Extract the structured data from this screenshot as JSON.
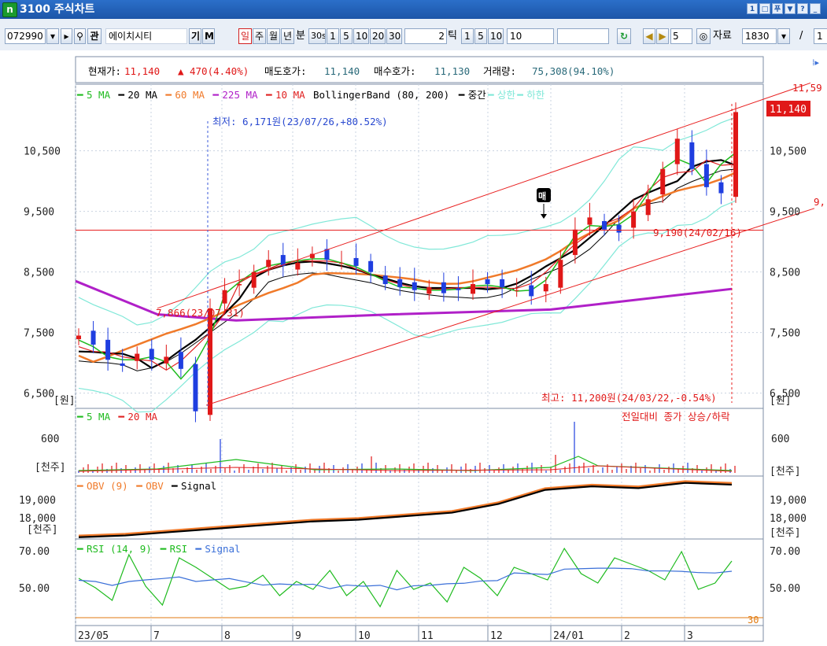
{
  "window": {
    "logo": "n",
    "title": "3100 주식차트",
    "controls": [
      "1",
      "□",
      "푸",
      "▼",
      "?",
      "_"
    ]
  },
  "toolbar": {
    "stock_code": "072990",
    "stock_name": "에이치시티",
    "gi_label": "기",
    "m_label": "M",
    "periods": [
      "일",
      "주",
      "월",
      "년",
      "분"
    ],
    "active_period": "일",
    "minute_buttons": [
      "30s",
      "1",
      "5",
      "10",
      "20",
      "30"
    ],
    "tick_value": "2",
    "tick_label": "틱",
    "tick_buttons": [
      "1",
      "5",
      "10"
    ],
    "tick_input": "10",
    "count_input": "5",
    "data_label": "자료",
    "data_count": "1830",
    "slash": "/",
    "page_value": "1"
  },
  "info": {
    "price_label": "현재가:",
    "price": "11,140",
    "change_arrow": "▲",
    "change": "470(4.40%)",
    "ask_label": "매도호가:",
    "ask": "11,140",
    "bid_label": "매수호가:",
    "bid": "11,130",
    "vol_label": "거래량:",
    "volume": "75,308(94.10%)"
  },
  "legend_main": [
    {
      "label": "5 MA",
      "color": "#1fbb1f"
    },
    {
      "label": "20 MA",
      "color": "#000000"
    },
    {
      "label": "60 MA",
      "color": "#f07a2a"
    },
    {
      "label": "225 MA",
      "color": "#b020c8"
    },
    {
      "label": "10 MA",
      "color": "#e02020"
    },
    {
      "label": "BollingerBand (80, 200)",
      "color": ""
    },
    {
      "label": "중간",
      "color": "#000000"
    },
    {
      "label": "상한",
      "color": "#80e8d8"
    },
    {
      "label": "하한",
      "color": "#80e8d8"
    }
  ],
  "annotations": {
    "low": "최저: 6,171원(23/07/26,+80.52%)",
    "high": "최고: 11,200원(24/03/22,-0.54%)",
    "level_1": "7,866(23/07/31)",
    "level_2": "9,190(24/02/16)",
    "buy_marker": "매",
    "trend_right_1": "11,59",
    "trend_right_2": "9,",
    "current_price_box": "11,140",
    "won_unit": "[원]"
  },
  "vol_panel": {
    "legend": [
      {
        "label": "5 MA",
        "color": "#1fbb1f"
      },
      {
        "label": "20 MA",
        "color": "#e02020"
      }
    ],
    "right_text": "전일대비 종가 상승/하락",
    "unit": "[천주]",
    "ticks": [
      "600"
    ]
  },
  "obv_panel": {
    "legend": [
      {
        "label": "OBV (9)",
        "color": "#f07a2a"
      },
      {
        "label": "OBV",
        "color": "#f07a2a"
      },
      {
        "label": "Signal",
        "color": "#000000"
      }
    ],
    "unit": "[천주]",
    "ticks": [
      "19,000",
      "18,000"
    ]
  },
  "rsi_panel": {
    "legend": [
      {
        "label": "RSI (14, 9)",
        "color": "#1fbb1f"
      },
      {
        "label": "RSI",
        "color": "#1fbb1f"
      },
      {
        "label": "Signal",
        "color": "#3a6fd8"
      }
    ],
    "ticks": [
      "70.00",
      "50.00"
    ],
    "corner": "30"
  },
  "price_axis": {
    "ticks": [
      "10,500",
      "9,500",
      "8,500",
      "7,500",
      "6,500"
    ]
  },
  "time_axis": [
    "23/05",
    "7",
    "8",
    "9",
    "10",
    "11",
    "12",
    "24/01",
    "2",
    "3"
  ],
  "colors": {
    "up": "#e01818",
    "down": "#1f3ee0",
    "grid": "#c9d3e0",
    "trend": "#e82020",
    "support": "#e82020"
  },
  "chart_data": {
    "type": "candlestick",
    "x_labels": [
      "23/05",
      "7",
      "8",
      "9",
      "10",
      "11",
      "12",
      "24/01",
      "2",
      "3"
    ],
    "price_range": [
      6300,
      11600
    ],
    "key_points": [
      {
        "date": "23/07/26",
        "value": 6171,
        "label": "최저"
      },
      {
        "date": "23/07/31",
        "value": 7866
      },
      {
        "date": "24/02/16",
        "value": 9190
      },
      {
        "date": "24/03/22",
        "value": 11200,
        "label": "최고"
      }
    ],
    "last_close": 11140,
    "horizontal_line": 9190,
    "price_path": [
      7450,
      7300,
      7050,
      6950,
      7150,
      7050,
      7100,
      6900,
      6200,
      7900,
      8200,
      8300,
      8500,
      8700,
      8600,
      8650,
      8800,
      8700,
      8650,
      8600,
      8500,
      8300,
      8250,
      8200,
      8250,
      8150,
      8200,
      8300,
      8300,
      8250,
      8200,
      8100,
      8300,
      8700,
      9200,
      9400,
      9200,
      9150,
      9500,
      9700,
      10200,
      10700,
      10200,
      9900,
      9800,
      11140
    ],
    "obv_path": [
      17.55,
      17.6,
      17.7,
      17.8,
      17.9,
      18.0,
      18.05,
      18.15,
      18.25,
      18.5,
      18.9,
      19.0,
      18.95,
      19.1,
      19.05
    ],
    "rsi_path": [
      55,
      49,
      41,
      70,
      50,
      38,
      68,
      62,
      55,
      48,
      50,
      57,
      44,
      53,
      48,
      60,
      44,
      53,
      37,
      60,
      48,
      52,
      40,
      62,
      55,
      44,
      62,
      58,
      54,
      74,
      58,
      52,
      68,
      64,
      60,
      54,
      72,
      48,
      52,
      66
    ]
  }
}
